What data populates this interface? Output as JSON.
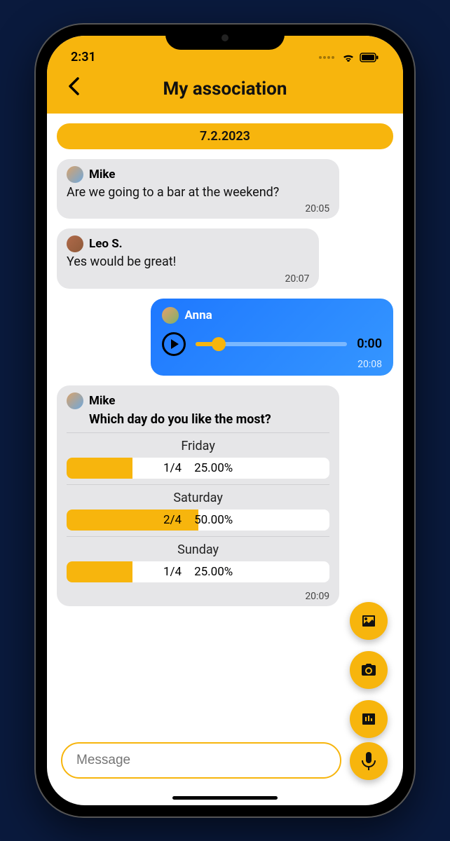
{
  "status": {
    "time": "2:31"
  },
  "header": {
    "title": "My association"
  },
  "date": "7.2.2023",
  "messages": {
    "m1": {
      "sender": "Mike",
      "text": "Are we going to a bar at the weekend?",
      "time": "20:05"
    },
    "m2": {
      "sender": "Leo S.",
      "text": "Yes would be great!",
      "time": "20:07"
    },
    "m3": {
      "sender": "Anna",
      "duration": "0:00",
      "time": "20:08"
    },
    "m4": {
      "sender": "Mike",
      "question": "Which day do you like the most?",
      "time": "20:09",
      "options": {
        "o1": {
          "label": "Friday",
          "count": "1/4",
          "pct": "25.00%",
          "fill": 25
        },
        "o2": {
          "label": "Saturday",
          "count": "2/4",
          "pct": "50.00%",
          "fill": 50
        },
        "o3": {
          "label": "Sunday",
          "count": "1/4",
          "pct": "25.00%",
          "fill": 25
        }
      }
    }
  },
  "input": {
    "placeholder": "Message"
  }
}
